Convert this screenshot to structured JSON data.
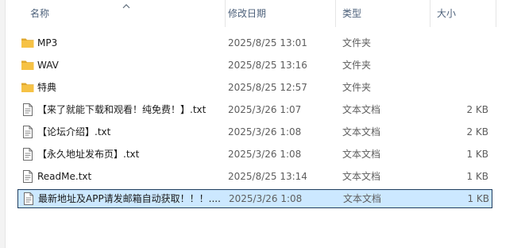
{
  "columns": {
    "name": "名称",
    "modified": "修改日期",
    "type": "类型",
    "size": "大小"
  },
  "sort": {
    "column": "name",
    "direction": "ascending"
  },
  "colors": {
    "folder": "#f6c245",
    "selection_bg": "#cce8ff",
    "selection_border": "#1f3d5e",
    "header_text": "#4c607a"
  },
  "files": [
    {
      "icon": "folder-icon",
      "name": "MP3",
      "modified": "2025/8/25 13:01",
      "type": "文件夹",
      "size": ""
    },
    {
      "icon": "folder-icon",
      "name": "WAV",
      "modified": "2025/8/25 13:16",
      "type": "文件夹",
      "size": ""
    },
    {
      "icon": "folder-icon",
      "name": "特典",
      "modified": "2025/8/25 12:57",
      "type": "文件夹",
      "size": ""
    },
    {
      "icon": "text-file-icon",
      "name": "【来了就能下载和观看！纯免费！】.txt",
      "modified": "2025/3/26 1:07",
      "type": "文本文档",
      "size": "2 KB"
    },
    {
      "icon": "text-file-icon",
      "name": "【论坛介绍】.txt",
      "modified": "2025/3/26 1:08",
      "type": "文本文档",
      "size": "2 KB"
    },
    {
      "icon": "text-file-icon",
      "name": "【永久地址发布页】.txt",
      "modified": "2025/3/26 1:08",
      "type": "文本文档",
      "size": "1 KB"
    },
    {
      "icon": "text-file-icon",
      "name": "ReadMe.txt",
      "modified": "2025/8/25 13:14",
      "type": "文本文档",
      "size": "1 KB"
    },
    {
      "icon": "text-file-icon",
      "name": "最新地址及APP请发邮箱自动获取！！！....",
      "modified": "2025/3/26 1:08",
      "type": "文本文档",
      "size": "1 KB",
      "selected": true
    }
  ]
}
